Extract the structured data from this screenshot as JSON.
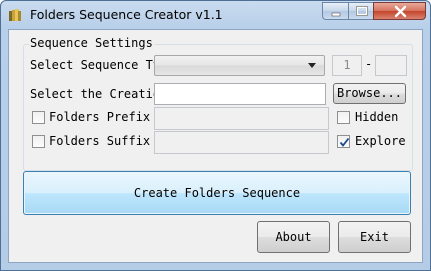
{
  "window": {
    "title": "Folders Sequence Creator v1.1",
    "icon": "folder-icon"
  },
  "caption_buttons": {
    "minimize": "minimize-icon",
    "maximize": "maximize-icon",
    "close": "close-icon"
  },
  "settings": {
    "group_title": "Sequence Settings",
    "sequence_type_label": "Select Sequence Type:",
    "sequence_type_value": "",
    "range_from": "1",
    "range_separator": "-",
    "range_to": "",
    "creation_label": "Select the Creation F",
    "creation_path": "",
    "browse_label": "Browse...",
    "prefix_label": "Folders Prefix",
    "prefix_checked": false,
    "prefix_value": "",
    "suffix_label": "Folders Suffix",
    "suffix_checked": false,
    "suffix_value": "",
    "hidden_label": "Hidden",
    "hidden_checked": false,
    "explore_label": "Explore",
    "explore_checked": true
  },
  "actions": {
    "create_label": "Create Folders Sequence",
    "about_label": "About",
    "exit_label": "Exit"
  }
}
